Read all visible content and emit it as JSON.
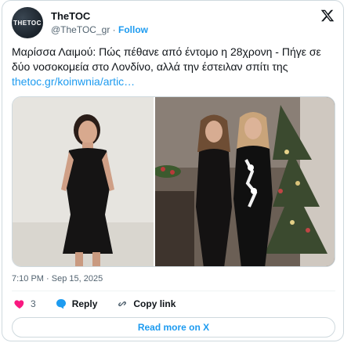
{
  "account": {
    "avatar_text": "THETOC",
    "name": "TheTOC",
    "handle": "@TheTOC_gr",
    "separator": "·",
    "follow_label": "Follow"
  },
  "tweet": {
    "text": "Μαρίσσα Λαιμού: Πώς πέθανε από έντομο η 28χρονη - Πήγε σε δύο νοσοκομεία στο Λονδίνο, αλλά την έστειλαν σπίτι της ",
    "link_text": "thetoc.gr/koinwnia/artic…",
    "timestamp": "7:10 PM · Sep 15, 2025"
  },
  "actions": {
    "like_count": "3",
    "reply_label": "Reply",
    "copy_label": "Copy link"
  },
  "read_more_label": "Read more on X",
  "colors": {
    "accent": "#1d9bf0",
    "like": "#f91880",
    "text_primary": "#0f1419",
    "text_secondary": "#536471",
    "border": "#cfd9de"
  },
  "icons": [
    "x-logo-icon",
    "heart-icon",
    "reply-icon",
    "link-icon"
  ]
}
